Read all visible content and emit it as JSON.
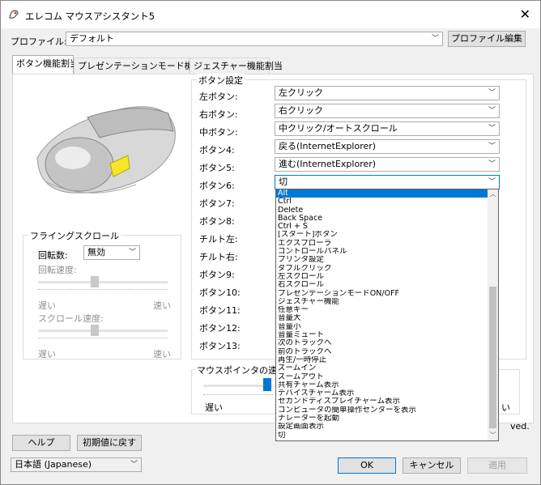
{
  "window": {
    "title": "エレコム マウスアシスタント5",
    "close_glyph": "✕"
  },
  "profile": {
    "label": "プロファイル:",
    "value": "デフォルト",
    "edit_button": "プロファイル編集"
  },
  "tabs": [
    "ボタン機能割当",
    "プレゼンテーションモード機能割当",
    "ジェスチャー機能割当"
  ],
  "button_settings": {
    "group_title": "ボタン設定",
    "rows": [
      {
        "label": "左ボタン:",
        "value": "左クリック"
      },
      {
        "label": "右ボタン:",
        "value": "右クリック"
      },
      {
        "label": "中ボタン:",
        "value": "中クリック/オートスクロール"
      },
      {
        "label": "ボタン4:",
        "value": "戻る(InternetExplorer)"
      },
      {
        "label": "ボタン5:",
        "value": "進む(InternetExplorer)"
      },
      {
        "label": "ボタン6:",
        "value": "切"
      },
      {
        "label": "ボタン7:"
      },
      {
        "label": "ボタン8:"
      },
      {
        "label": "チルト左:"
      },
      {
        "label": "チルト右:"
      },
      {
        "label": "ボタン9:"
      },
      {
        "label": "ボタン10:"
      },
      {
        "label": "ボタン11:"
      },
      {
        "label": "ボタン12:"
      },
      {
        "label": "ボタン13:"
      }
    ]
  },
  "dropdown_options": [
    "Alt",
    "Ctrl",
    "Delete",
    "Back Space",
    "Ctrl + S",
    "[スタート]ボタン",
    "エクスプローラ",
    "コントロールパネル",
    "プリンタ設定",
    "ダブルクリック",
    "左スクロール",
    "右スクロール",
    "プレゼンテーションモードON/OFF",
    "ジェスチャー機能",
    "任意キー",
    "音量大",
    "音量小",
    "音量ミュート",
    "次のトラックへ",
    "前のトラックへ",
    "再生/一時停止",
    "ズームイン",
    "ズームアウト",
    "共有チャーム表示",
    "デバイスチャーム表示",
    "セカンドディスプレイチャーム表示",
    "コンピュータの簡単操作センターを表示",
    "ナレーターを起動",
    "設定画面表示",
    "切"
  ],
  "dropdown_selected_index": 0,
  "flying_scroll": {
    "group_title": "フライングスクロール",
    "rotations_label": "回転数:",
    "rotations_value": "無効",
    "rotation_speed_label": "回転速度:",
    "scroll_speed_label": "スクロール速度:",
    "slow": "遅い",
    "fast": "速い"
  },
  "pointer_speed": {
    "group_title": "マウスポインタの速度",
    "slow": "遅い",
    "fast": "い"
  },
  "copyright_fragment": "ved.",
  "footer": {
    "help_button": "ヘルプ",
    "reset_button": "初期値に戻す",
    "language_value": "日本語 (Japanese)",
    "ok_button": "OK",
    "cancel_button": "キャンセル",
    "apply_button": "適用"
  },
  "colors": {
    "accent": "#0078d7",
    "mouse_highlight": "#f5e62a"
  }
}
